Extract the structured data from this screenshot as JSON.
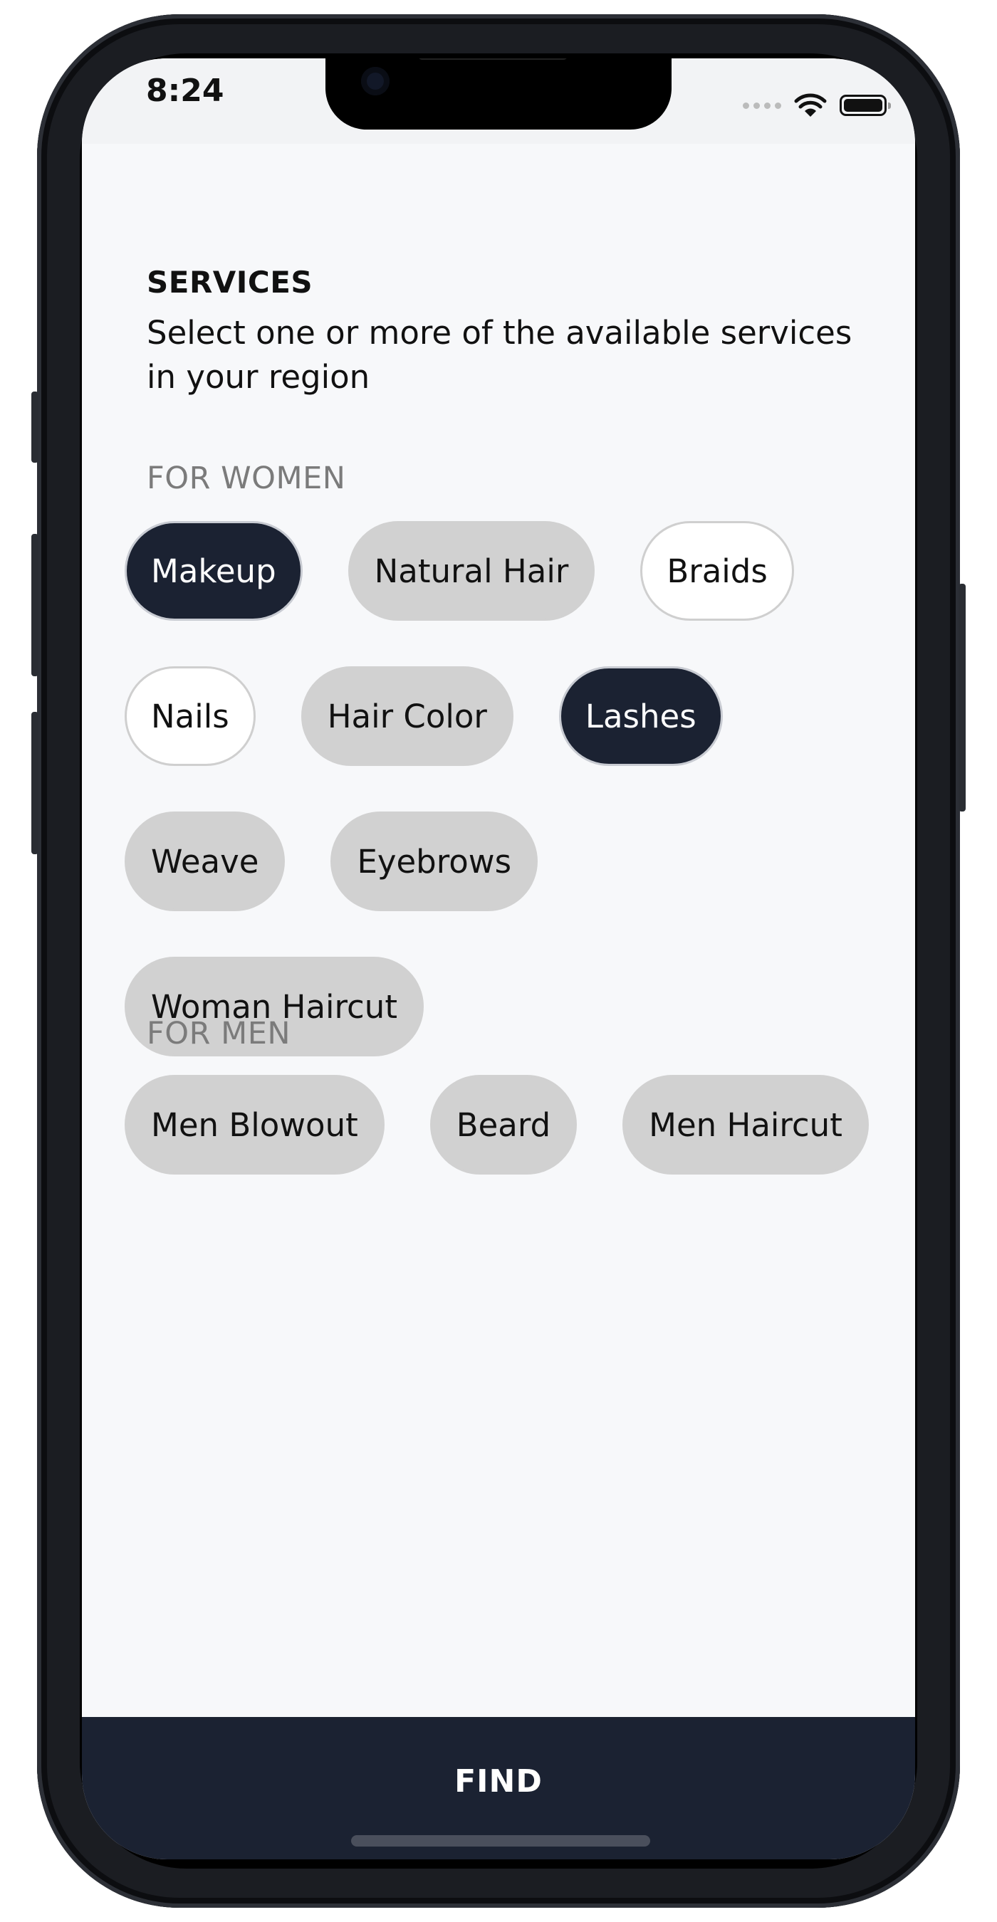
{
  "status_bar": {
    "time": "8:24"
  },
  "header": {
    "title": "SERVICES",
    "subtitle": "Select one or more of the available services in your region"
  },
  "women": {
    "label": "FOR WOMEN",
    "chips": [
      {
        "label": "Makeup",
        "state": "selected"
      },
      {
        "label": "Natural Hair",
        "state": "default"
      },
      {
        "label": "Braids",
        "state": "outline"
      },
      {
        "label": "Nails",
        "state": "outline"
      },
      {
        "label": "Hair Color",
        "state": "default"
      },
      {
        "label": "Lashes",
        "state": "selected"
      },
      {
        "label": "Weave",
        "state": "default"
      },
      {
        "label": "Eyebrows",
        "state": "default"
      },
      {
        "label": "Woman Haircut",
        "state": "default"
      }
    ]
  },
  "men": {
    "label": "FOR MEN",
    "chips": [
      {
        "label": "Men Blowout",
        "state": "default"
      },
      {
        "label": "Beard",
        "state": "default"
      },
      {
        "label": "Men Haircut",
        "state": "default"
      }
    ]
  },
  "footer": {
    "find_label": "FIND"
  },
  "colors": {
    "primary": "#1b2232",
    "chip_default": "#d1d1d1",
    "background": "#f7f8fa"
  },
  "icons": [
    "wifi-icon",
    "battery-icon",
    "signal-dots-icon",
    "front-camera"
  ]
}
